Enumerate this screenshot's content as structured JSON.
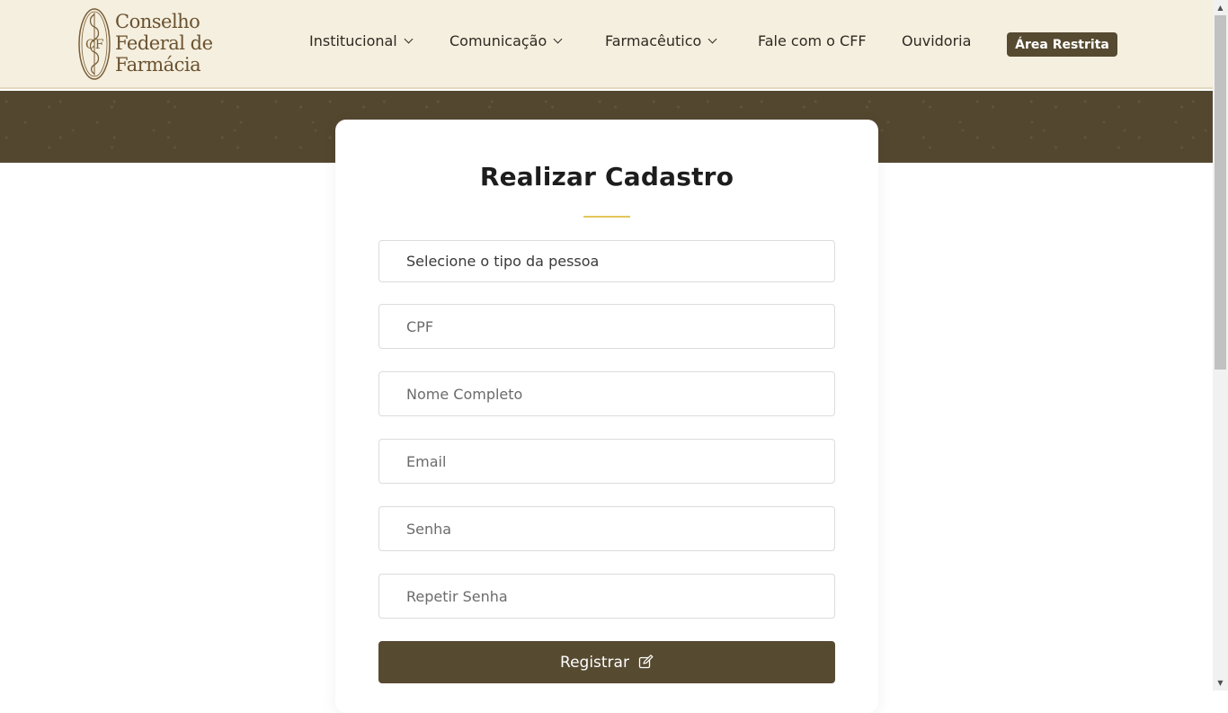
{
  "header": {
    "logo": {
      "line1": "Conselho",
      "line2": "Federal de",
      "line3": "Farmácia"
    },
    "nav": [
      {
        "label": "Institucional",
        "has_dropdown": true
      },
      {
        "label": "Comunicação",
        "has_dropdown": true
      },
      {
        "label": "Farmacêutico",
        "has_dropdown": true
      },
      {
        "label": "Fale com o CFF",
        "has_dropdown": false
      },
      {
        "label": "Ouvidoria",
        "has_dropdown": false
      }
    ],
    "restricted_button": "Área Restrita"
  },
  "form": {
    "title": "Realizar Cadastro",
    "person_type_select": "Selecione o tipo da pessoa",
    "fields": {
      "cpf": "CPF",
      "full_name": "Nome Completo",
      "email": "Email",
      "password": "Senha",
      "repeat_password": "Repetir Senha"
    },
    "submit_label": "Registrar",
    "submit_icon": "edit-icon"
  },
  "colors": {
    "header_bg": "#f5efdf",
    "brand_brown": "#564a31",
    "accent_gold": "#e4c65a"
  }
}
